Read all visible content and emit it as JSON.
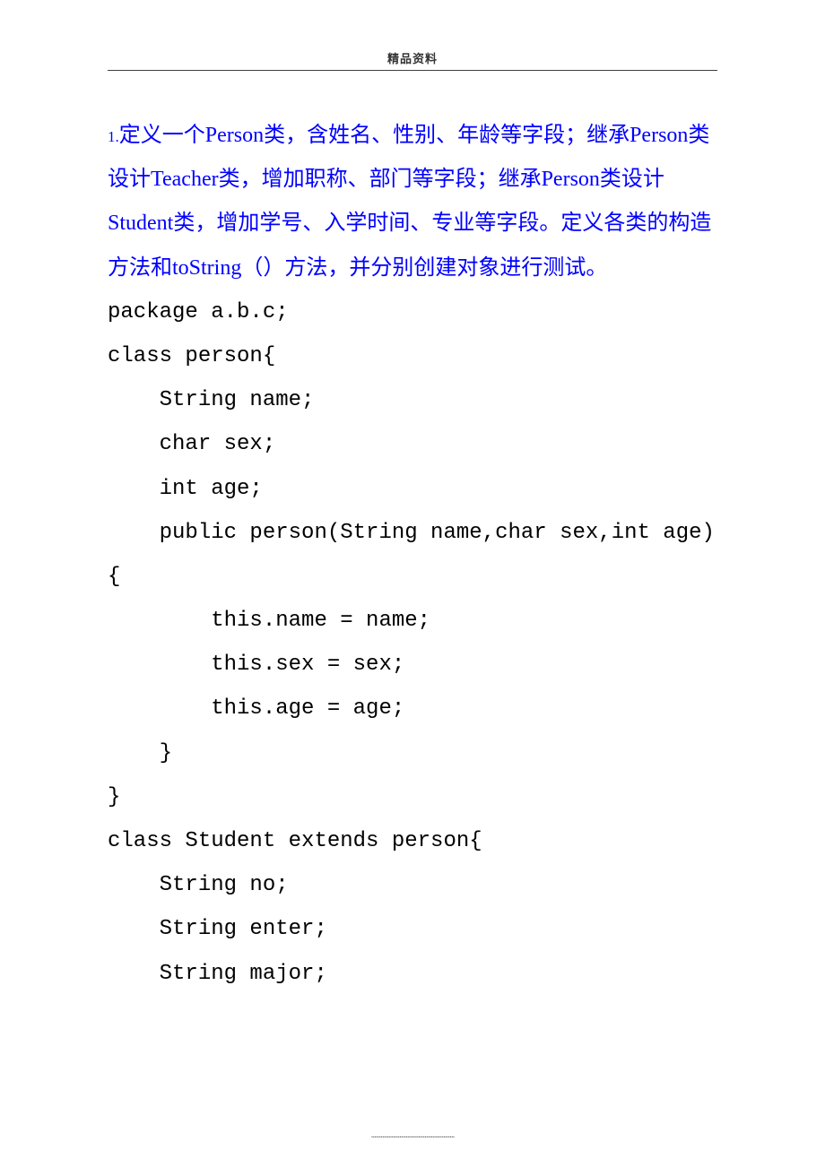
{
  "header": {
    "title": "精品资料"
  },
  "question": {
    "number": "1.",
    "text": "定义一个Person类，含姓名、性别、年龄等字段；继承Person类设计Teacher类，增加职称、部门等字段；继承Person类设计Student类，增加学号、入学时间、专业等字段。定义各类的构造方法和toString（）方法，并分别创建对象进行测试。"
  },
  "code": {
    "line1": "package a.b.c;",
    "line2": "class person{",
    "line3": "    String name;",
    "line4": "    char sex;",
    "line5": "    int age;",
    "line6": "    public person(String name,char sex,int age){",
    "line7": "        this.name = name;",
    "line8": "        this.sex = sex;",
    "line9": "        this.age = age;",
    "line10": "    }",
    "line11": "}",
    "line12": "class Student extends person{",
    "line13": "    String no;",
    "line14": "    String enter;",
    "line15": "    String major;"
  },
  "footer": {
    "dots": "....................................................."
  }
}
